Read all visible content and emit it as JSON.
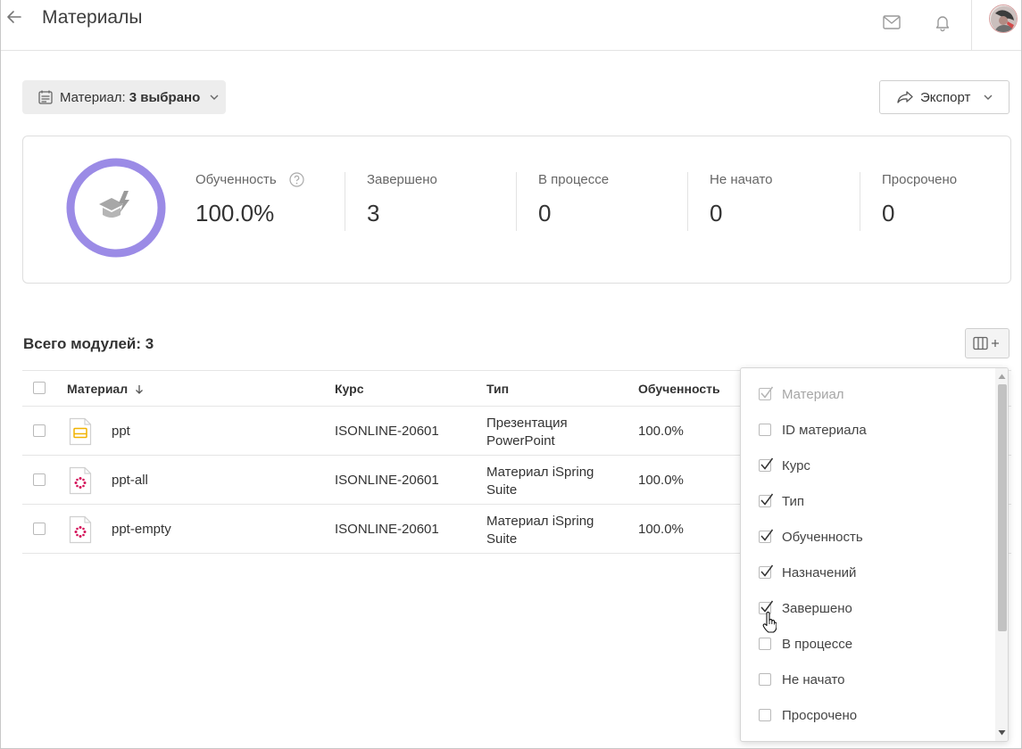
{
  "header": {
    "title": "Материалы"
  },
  "filter": {
    "label": "Материал:",
    "value": "3 выбрано"
  },
  "export": {
    "label": "Экспорт"
  },
  "summary": {
    "progress_fraction": 1.0,
    "ring_color": "#9b8be6",
    "stats": [
      {
        "label": "Обученность",
        "value": "100.0%"
      },
      {
        "label": "Завершено",
        "value": "3"
      },
      {
        "label": "В процессе",
        "value": "0"
      },
      {
        "label": "Не начато",
        "value": "0"
      },
      {
        "label": "Просрочено",
        "value": "0"
      }
    ]
  },
  "total": {
    "label": "Всего модулей: 3"
  },
  "table": {
    "columns": [
      "Материал",
      "Курс",
      "Тип",
      "Обученность"
    ],
    "rows": [
      {
        "name": "ppt",
        "course": "ISONLINE-20601",
        "type_line1": "Презентация",
        "type_line2": "PowerPoint",
        "progress": "100.0%",
        "icon": "powerpoint-file-icon"
      },
      {
        "name": "ppt-all",
        "course": "ISONLINE-20601",
        "type_line1": "Материал iSpring",
        "type_line2": "Suite",
        "progress": "100.0%",
        "icon": "ispring-file-icon"
      },
      {
        "name": "ppt-empty",
        "course": "ISONLINE-20601",
        "type_line1": "Материал iSpring",
        "type_line2": "Suite",
        "progress": "100.0%",
        "icon": "ispring-file-icon"
      }
    ]
  },
  "column_chooser": {
    "items": [
      {
        "label": "Материал",
        "checked": true,
        "disabled": true
      },
      {
        "label": "ID материала",
        "checked": false,
        "disabled": false
      },
      {
        "label": "Курс",
        "checked": true,
        "disabled": false
      },
      {
        "label": "Тип",
        "checked": true,
        "disabled": false
      },
      {
        "label": "Обученность",
        "checked": true,
        "disabled": false
      },
      {
        "label": "Назначений",
        "checked": true,
        "disabled": false
      },
      {
        "label": "Завершено",
        "checked": true,
        "disabled": false
      },
      {
        "label": "В процессе",
        "checked": false,
        "disabled": false
      },
      {
        "label": "Не начато",
        "checked": false,
        "disabled": false
      },
      {
        "label": "Просрочено",
        "checked": false,
        "disabled": false
      }
    ]
  }
}
